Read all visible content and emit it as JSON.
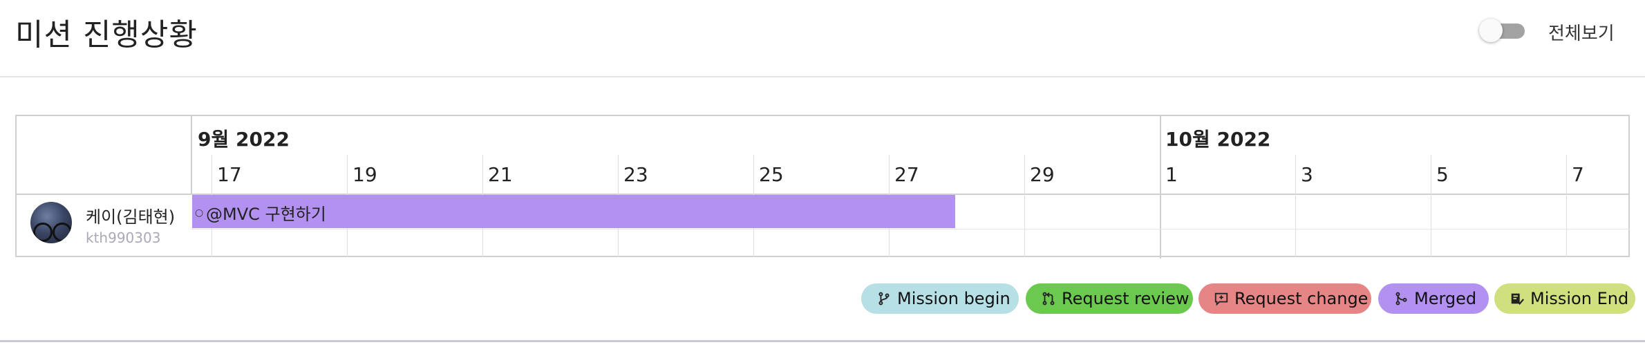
{
  "header": {
    "title": "미션 진행상황",
    "toggle": {
      "label": "전체보기",
      "checked": false
    }
  },
  "gantt": {
    "months": [
      {
        "label": "9월 2022"
      },
      {
        "label": "10월 2022"
      }
    ],
    "days": [
      "17",
      "19",
      "21",
      "23",
      "25",
      "27",
      "29",
      "1",
      "3",
      "5",
      "7"
    ],
    "rows": [
      {
        "user_name": "케이(김태현)",
        "user_id": "kth990303",
        "task": {
          "label": "@MVC 구현하기",
          "status": "Merged",
          "color": "#b291f1"
        }
      }
    ]
  },
  "legend": [
    {
      "label": "Mission begin",
      "icon": "branch-icon",
      "color": "#b6dfe6"
    },
    {
      "label": "Request review",
      "icon": "pull-request-icon",
      "color": "#6cc94f"
    },
    {
      "label": "Request change",
      "icon": "comment-diff-icon",
      "color": "#e68585"
    },
    {
      "label": "Merged",
      "icon": "merge-icon",
      "color": "#b291f1"
    },
    {
      "label": "Mission End",
      "icon": "checklist-icon",
      "color": "#d0e07e"
    }
  ]
}
